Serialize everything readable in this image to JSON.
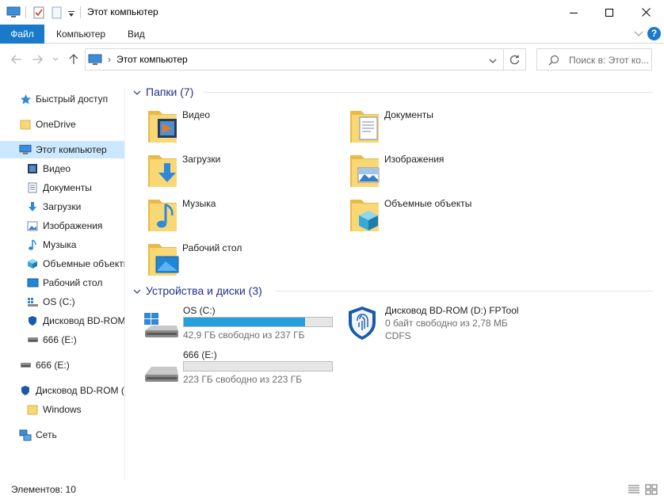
{
  "window": {
    "title": "Этот компьютер"
  },
  "ribbon": {
    "tabs": [
      {
        "label": "Файл"
      },
      {
        "label": "Компьютер"
      },
      {
        "label": "Вид"
      }
    ],
    "help_label": "?"
  },
  "address": {
    "path": "Этот компьютер",
    "separator": "›"
  },
  "search": {
    "placeholder": "Поиск в: Этот ко..."
  },
  "nav": {
    "quick_access": "Быстрый доступ",
    "onedrive": "OneDrive",
    "this_pc": "Этот компьютер",
    "video": "Видео",
    "documents": "Документы",
    "downloads": "Загрузки",
    "images": "Изображения",
    "music": "Музыка",
    "objects3d": "Объемные объекты",
    "desktop": "Рабочий стол",
    "os_c": "OS (C:)",
    "bdrom_sub": "Дисковод BD-ROM",
    "e_sub": "666 (E:)",
    "e_root": "666 (E:)",
    "bdrom_root": "Дисковод BD-ROM (",
    "windows": "Windows",
    "network": "Сеть"
  },
  "folders_group": {
    "title": "Папки (7)",
    "items": [
      {
        "label": "Видео",
        "icon": "video-folder-icon"
      },
      {
        "label": "Документы",
        "icon": "documents-folder-icon"
      },
      {
        "label": "Загрузки",
        "icon": "downloads-folder-icon"
      },
      {
        "label": "Изображения",
        "icon": "images-folder-icon"
      },
      {
        "label": "Музыка",
        "icon": "music-folder-icon"
      },
      {
        "label": "Объемные объекты",
        "icon": "3d-objects-folder-icon"
      },
      {
        "label": "Рабочий стол",
        "icon": "desktop-folder-icon"
      }
    ]
  },
  "drives_group": {
    "title": "Устройства и диски (3)",
    "drives": [
      {
        "name": "OS (C:)",
        "free": "42,9 ГБ свободно из 237 ГБ",
        "used_fraction": 0.82
      },
      {
        "name": "Дисковод BD-ROM (D:) FPTool",
        "free": "0 байт свободно из 2,78 МБ",
        "fs": "CDFS"
      },
      {
        "name": "666 (E:)",
        "free": "223 ГБ свободно из 223 ГБ",
        "used_fraction": 0.0
      }
    ]
  },
  "status": {
    "items_count": "Элементов: 10"
  },
  "colors": {
    "accent": "#1979ca",
    "selection": "#cce8ff",
    "progress": "#26a0da",
    "group_header": "#1e3287"
  }
}
